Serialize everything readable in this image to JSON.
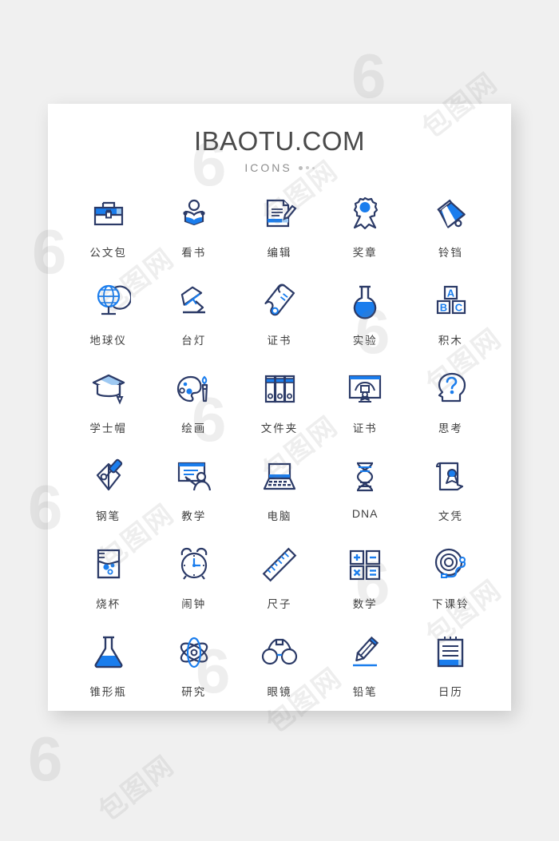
{
  "page": {
    "background_color": "#f0f0f0",
    "card_color": "#ffffff"
  },
  "header": {
    "brand": "IBAOTU.COM",
    "subtitle": "ICONS",
    "dots_count": 3
  },
  "colors": {
    "navy": "#2b3a67",
    "blue": "#1a7ded",
    "light_blue": "#9ec9f2",
    "label": "#3e3e3e",
    "brand": "#4a4a4a",
    "subtitle": "#8e8e8e"
  },
  "watermark": {
    "six": "6",
    "cn": "包图网"
  },
  "icons": [
    {
      "label": "公文包",
      "name": "briefcase-icon",
      "script": "cn"
    },
    {
      "label": "看书",
      "name": "reading-person-icon",
      "script": "cn"
    },
    {
      "label": "编辑",
      "name": "edit-document-icon",
      "script": "cn"
    },
    {
      "label": "奖章",
      "name": "medal-icon",
      "script": "cn"
    },
    {
      "label": "铃铛",
      "name": "bell-icon",
      "script": "cn"
    },
    {
      "label": "地球仪",
      "name": "globe-icon",
      "script": "cn"
    },
    {
      "label": "台灯",
      "name": "desk-lamp-icon",
      "script": "cn"
    },
    {
      "label": "证书",
      "name": "scroll-certificate-icon",
      "script": "cn"
    },
    {
      "label": "实验",
      "name": "round-flask-icon",
      "script": "cn"
    },
    {
      "label": "积木",
      "name": "abc-blocks-icon",
      "script": "cn",
      "letters": [
        "A",
        "B",
        "C"
      ]
    },
    {
      "label": "学士帽",
      "name": "graduation-cap-icon",
      "script": "cn"
    },
    {
      "label": "绘画",
      "name": "palette-brush-icon",
      "script": "cn"
    },
    {
      "label": "文件夹",
      "name": "binders-icon",
      "script": "cn"
    },
    {
      "label": "证书",
      "name": "diploma-board-icon",
      "script": "cn"
    },
    {
      "label": "思考",
      "name": "thinking-head-icon",
      "script": "cn"
    },
    {
      "label": "钢笔",
      "name": "fountain-pen-icon",
      "script": "cn"
    },
    {
      "label": "教学",
      "name": "teaching-board-icon",
      "script": "cn"
    },
    {
      "label": "电脑",
      "name": "laptop-icon",
      "script": "cn"
    },
    {
      "label": "DNA",
      "name": "dna-icon",
      "script": "latin"
    },
    {
      "label": "文凭",
      "name": "diploma-scroll-icon",
      "script": "cn"
    },
    {
      "label": "烧杯",
      "name": "beaker-icon",
      "script": "cn"
    },
    {
      "label": "闹钟",
      "name": "alarm-clock-icon",
      "script": "cn"
    },
    {
      "label": "尺子",
      "name": "ruler-icon",
      "script": "cn"
    },
    {
      "label": "数学",
      "name": "math-symbols-icon",
      "script": "cn",
      "symbols": [
        "+",
        "−",
        "×",
        "="
      ]
    },
    {
      "label": "下课铃",
      "name": "school-bell-icon",
      "script": "cn"
    },
    {
      "label": "锥形瓶",
      "name": "conical-flask-icon",
      "script": "cn"
    },
    {
      "label": "研究",
      "name": "atom-research-icon",
      "script": "cn"
    },
    {
      "label": "眼镜",
      "name": "glasses-icon",
      "script": "cn"
    },
    {
      "label": "铅笔",
      "name": "pencil-icon",
      "script": "cn"
    },
    {
      "label": "日历",
      "name": "notepad-calendar-icon",
      "script": "cn"
    }
  ]
}
